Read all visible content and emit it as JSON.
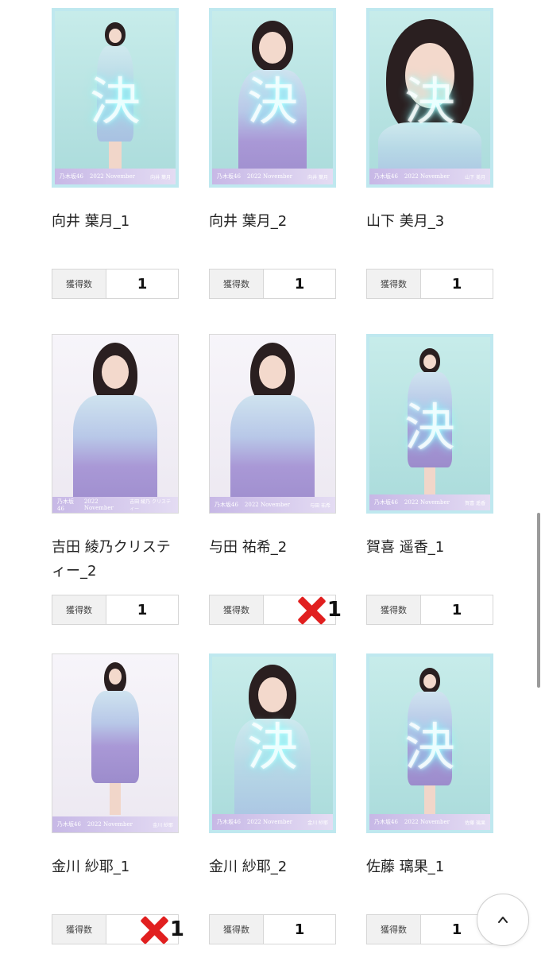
{
  "items": [
    {
      "title": "向井 葉月_1",
      "count_label": "獲得数",
      "count": "1",
      "crossed": false
    },
    {
      "title": "向井 葉月_2",
      "count_label": "獲得数",
      "count": "1",
      "crossed": false
    },
    {
      "title": "山下 美月_3",
      "count_label": "獲得数",
      "count": "1",
      "crossed": false
    },
    {
      "title": "吉田 綾乃クリスティー_2",
      "count_label": "獲得数",
      "count": "1",
      "crossed": false
    },
    {
      "title": "与田 祐希_2",
      "count_label": "獲得数",
      "count": "1",
      "crossed": true
    },
    {
      "title": "賀喜 遥香_1",
      "count_label": "獲得数",
      "count": "1",
      "crossed": false
    },
    {
      "title": "金川 紗耶_1",
      "count_label": "獲得数",
      "count": "1",
      "crossed": true
    },
    {
      "title": "金川 紗耶_2",
      "count_label": "獲得数",
      "count": "1",
      "crossed": false
    },
    {
      "title": "佐藤 璃果_1",
      "count_label": "獲得数",
      "count": "1",
      "crossed": false
    }
  ],
  "photo_footer": {
    "brand": "乃木坂46",
    "edition": "2022 November"
  },
  "photo_names": [
    "向井 葉月",
    "向井 葉月",
    "山下 美月",
    "吉田 綾乃 クリスティー",
    "与田 祐希",
    "賀喜 遥香",
    "金川 紗耶",
    "金川 紗耶",
    "佐藤 璃果"
  ],
  "stamp_char": "決",
  "scroll_top_icon": "chevron-up-icon"
}
